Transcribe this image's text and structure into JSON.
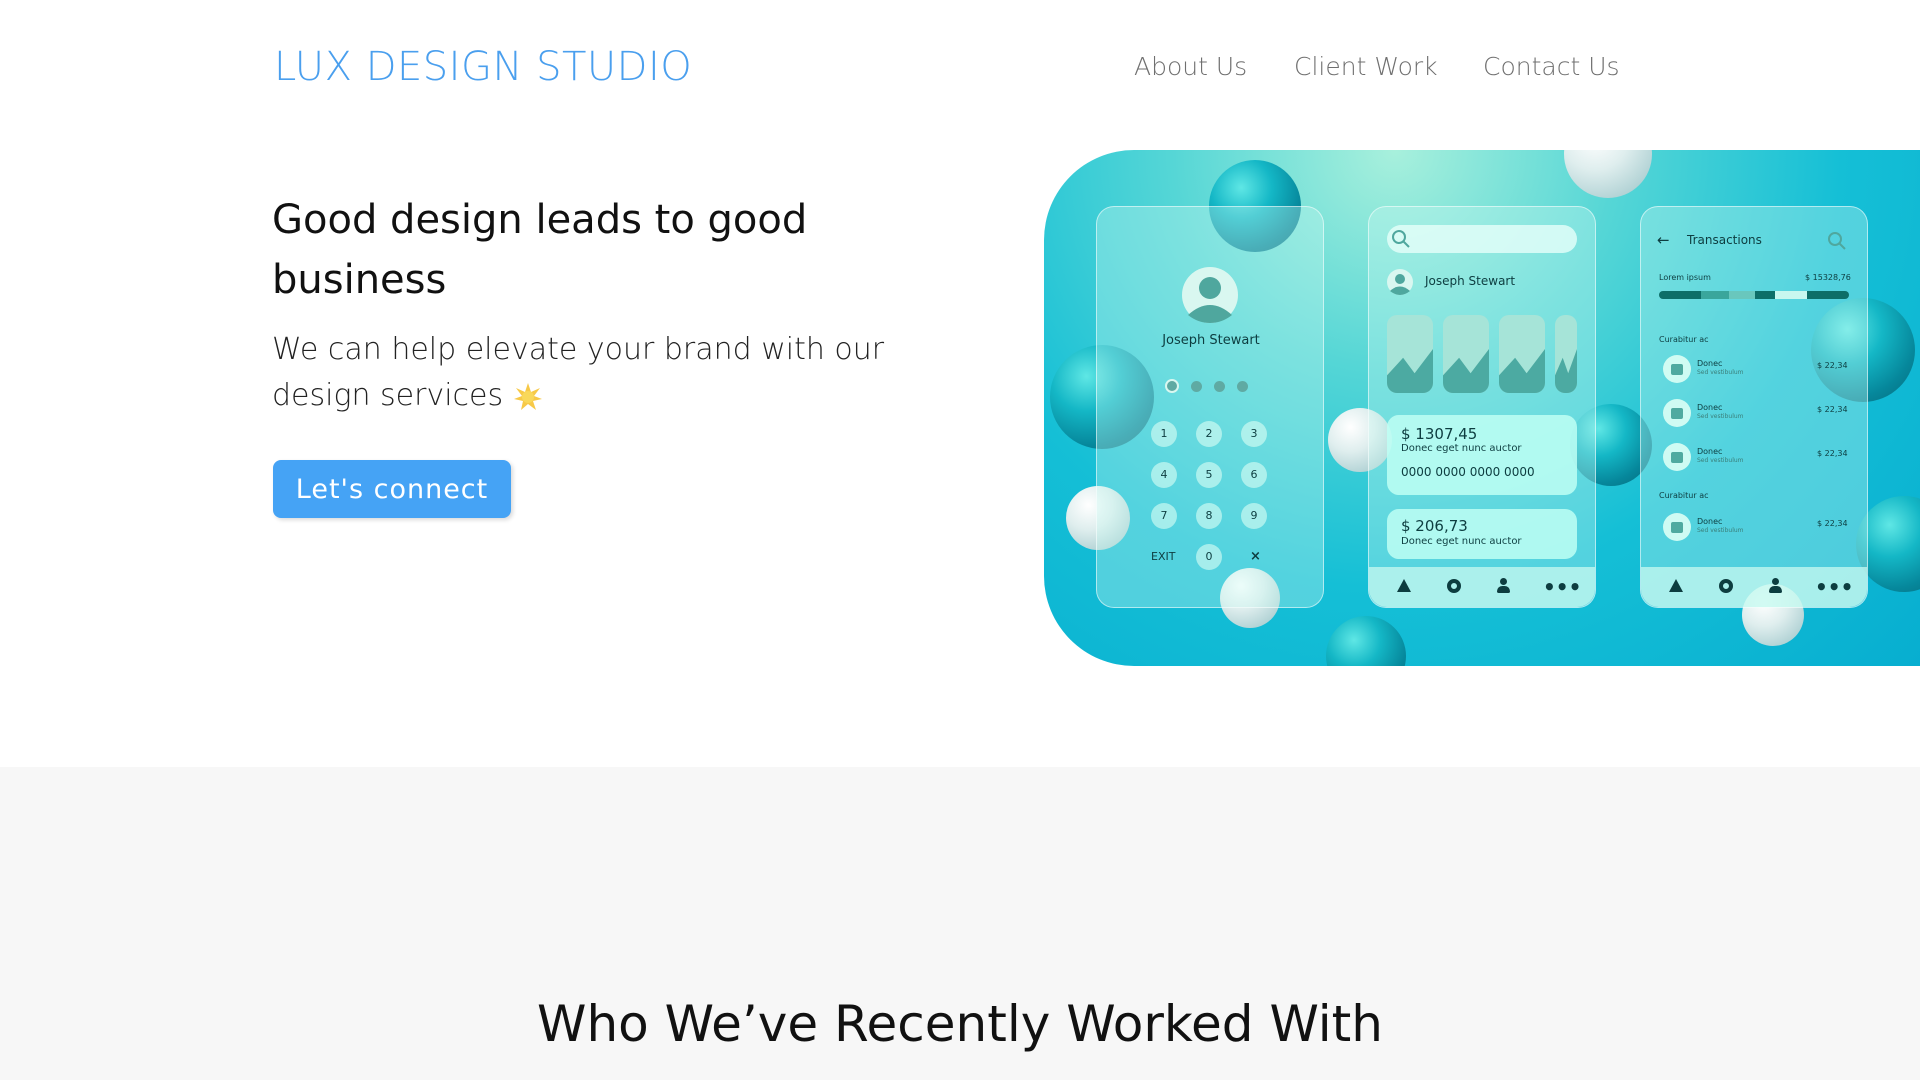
{
  "header": {
    "brand": "LUX DESIGN STUDIO",
    "nav": [
      "About Us",
      "Client Work",
      "Contact Us"
    ]
  },
  "hero": {
    "title": "Good design leads to good business",
    "subtitle": "We can help elevate your brand with our design services",
    "cta": "Let's connect",
    "image": {
      "phone1": {
        "name": "Joseph Stewart",
        "keys": [
          "1",
          "2",
          "3",
          "4",
          "5",
          "6",
          "7",
          "8",
          "9",
          "EXIT",
          "0",
          "×"
        ]
      },
      "phone2": {
        "name": "Joseph Stewart",
        "card1_amount": "$ 1307,45",
        "card1_desc": "Donec eget nunc auctor",
        "card1_number": "0000 0000 0000 0000",
        "card2_amount": "$ 206,73",
        "card2_desc": "Donec eget nunc auctor"
      },
      "phone3": {
        "title": "Transactions",
        "summary_label": "Lorem ipsum",
        "summary_value": "$ 15328,76",
        "group1": "Curabitur ac",
        "group2": "Curabitur ac",
        "item_title": "Donec",
        "item_sub": "Sed vestibulum",
        "item_amount": "$ 22,34"
      }
    }
  },
  "clients": {
    "title": "Who We’ve Recently Worked With"
  },
  "colors": {
    "accent": "#45a3f5",
    "brand": "#4a9fee",
    "band": "#f7f7f7"
  }
}
